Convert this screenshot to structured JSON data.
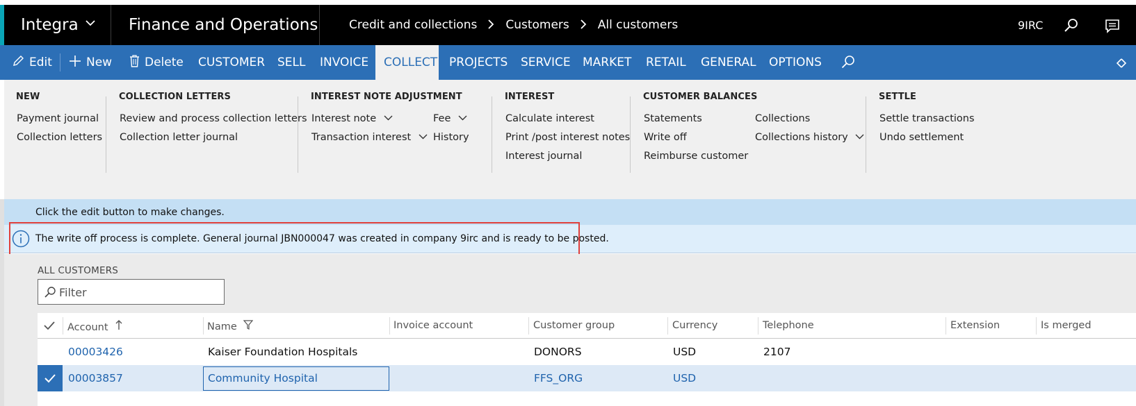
{
  "topbar": {
    "company": "Integra",
    "app_name": "Finance and Operations",
    "breadcrumbs": [
      "Credit and collections",
      "Customers",
      "All customers"
    ],
    "company_code": "9IRC",
    "icons": [
      "chevron-down-icon",
      "search-icon",
      "message-icon"
    ]
  },
  "actionbar": {
    "edit": "Edit",
    "new": "New",
    "delete": "Delete",
    "tabs": [
      "CUSTOMER",
      "SELL",
      "INVOICE",
      "COLLECT",
      "PROJECTS",
      "SERVICE",
      "MARKET",
      "RETAIL",
      "GENERAL",
      "OPTIONS"
    ],
    "active_tab": "COLLECT"
  },
  "ribbon": {
    "new": {
      "title": "NEW",
      "items": [
        "Payment journal",
        "Collection letters"
      ]
    },
    "collection_letters": {
      "title": "COLLECTION LETTERS",
      "items": [
        "Review and process collection letters",
        "Collection letter journal"
      ]
    },
    "interest_note_adjustment": {
      "title": "INTEREST NOTE ADJUSTMENT",
      "items": [
        "Interest note",
        "Transaction interest",
        "Fee",
        "History"
      ]
    },
    "interest": {
      "title": "INTEREST",
      "items": [
        "Calculate interest",
        "Print /post interest notes",
        "Interest journal"
      ]
    },
    "customer_balances": {
      "title": "CUSTOMER BALANCES",
      "items": [
        "Statements",
        "Write off",
        "Reimburse customer",
        "Collections",
        "Collections history"
      ]
    },
    "settle": {
      "title": "SETTLE",
      "items": [
        "Settle transactions",
        "Undo settlement"
      ]
    }
  },
  "messages": {
    "edit_hint": "Click the edit button to make changes.",
    "info": "The write off process is complete.   General journal JBN000047 was created in company 9irc and is ready to be posted."
  },
  "list": {
    "title": "ALL CUSTOMERS",
    "filter_placeholder": "Filter",
    "columns": [
      "Account",
      "Name",
      "Invoice account",
      "Customer group",
      "Currency",
      "Telephone",
      "Extension",
      "Is merged"
    ],
    "rows": [
      {
        "account": "00003426",
        "name": "Kaiser Foundation Hospitals",
        "invoice_account": "",
        "customer_group": "DONORS",
        "currency": "USD",
        "telephone": "2107",
        "extension": "",
        "is_merged": ""
      },
      {
        "account": "00003857",
        "name": "Community Hospital",
        "invoice_account": "",
        "customer_group": "FFS_ORG",
        "currency": "USD",
        "telephone": "",
        "extension": "",
        "is_merged": ""
      }
    ],
    "selected_row": 1
  },
  "colors": {
    "topbar": "#000000",
    "actionbar": "#2c6fb6",
    "ribbon": "#f0f0f0",
    "link": "#1f63ad",
    "highlight_border": "#e0403c",
    "selected_row": "#dde9f6"
  }
}
